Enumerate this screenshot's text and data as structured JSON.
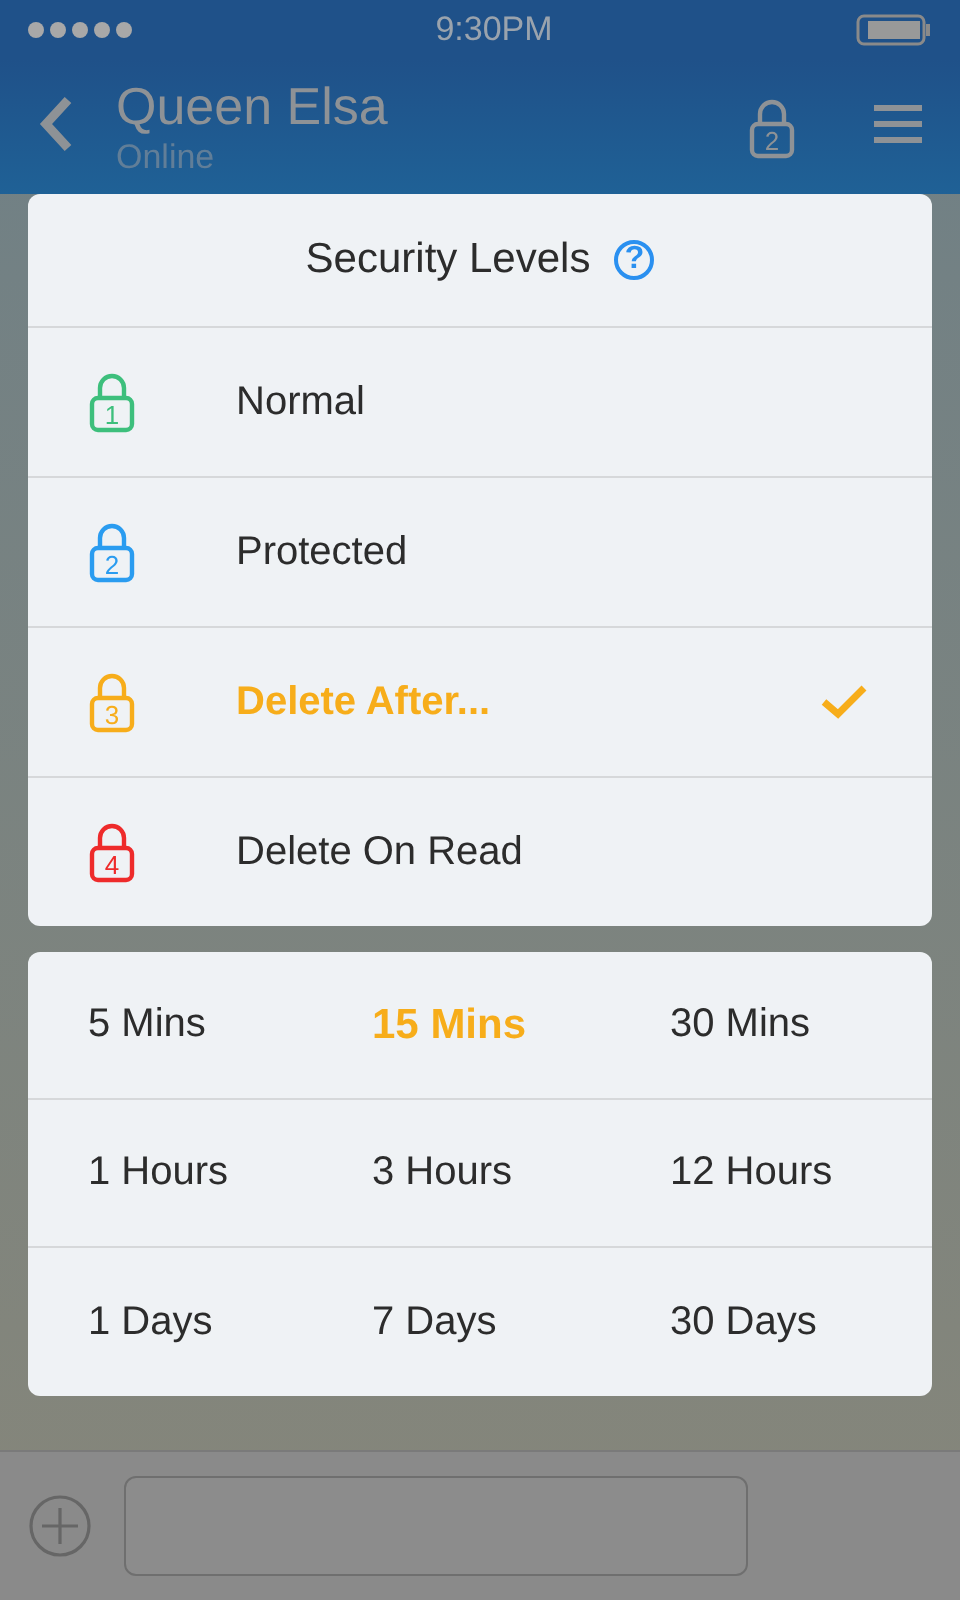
{
  "status_bar": {
    "time": "9:30PM"
  },
  "nav": {
    "title": "Queen Elsa",
    "subtitle": "Online",
    "lock_number": "2"
  },
  "security": {
    "title": "Security Levels",
    "help": "?",
    "levels": [
      {
        "number": "1",
        "label": "Normal",
        "color": "#3dbf7c",
        "selected": false
      },
      {
        "number": "2",
        "label": "Protected",
        "color": "#2a9cf0",
        "selected": false
      },
      {
        "number": "3",
        "label": "Delete After...",
        "color": "#f7ad1a",
        "selected": true
      },
      {
        "number": "4",
        "label": "Delete On Read",
        "color": "#ee2b2b",
        "selected": false
      }
    ]
  },
  "durations": [
    {
      "label": "5 Mins",
      "selected": false
    },
    {
      "label": "15 Mins",
      "selected": true
    },
    {
      "label": "30 Mins",
      "selected": false
    },
    {
      "label": "1 Hours",
      "selected": false
    },
    {
      "label": "3 Hours",
      "selected": false
    },
    {
      "label": "12 Hours",
      "selected": false
    },
    {
      "label": "1 Days",
      "selected": false
    },
    {
      "label": "7 Days",
      "selected": false
    },
    {
      "label": "30 Days",
      "selected": false
    }
  ]
}
